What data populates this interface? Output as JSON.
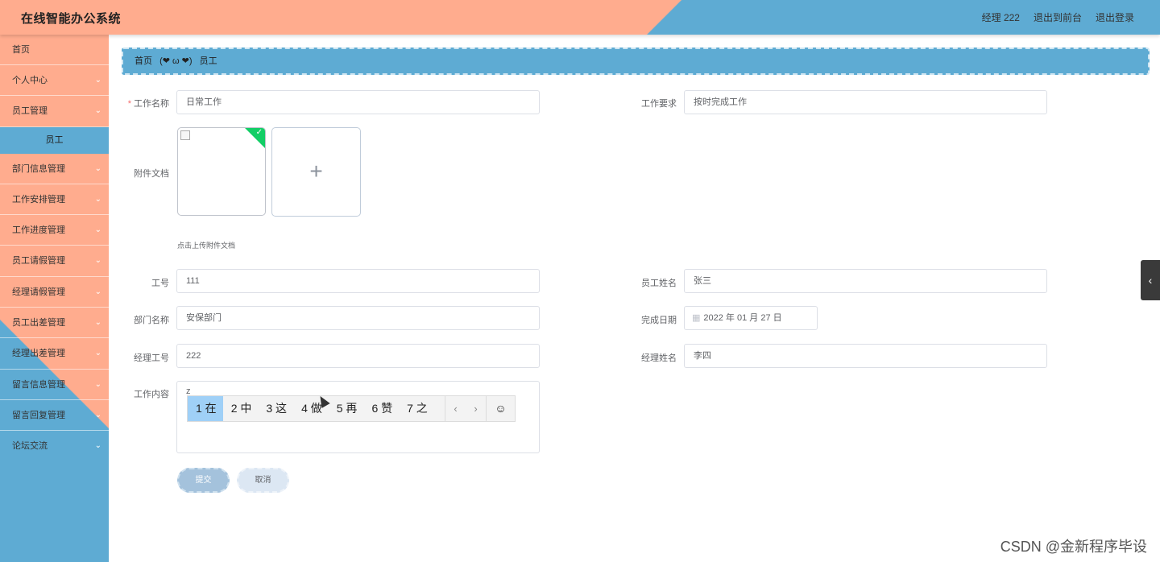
{
  "header": {
    "app_title": "在线智能办公系统",
    "user_label": "经理 222",
    "exit_front": "退出到前台",
    "logout": "退出登录"
  },
  "sidebar": {
    "items": [
      {
        "label": "首页",
        "has_children": false
      },
      {
        "label": "个人中心",
        "has_children": true
      },
      {
        "label": "员工管理",
        "has_children": true
      },
      {
        "label": "部门信息管理",
        "has_children": true
      },
      {
        "label": "工作安排管理",
        "has_children": true
      },
      {
        "label": "工作进度管理",
        "has_children": true
      },
      {
        "label": "员工请假管理",
        "has_children": true
      },
      {
        "label": "经理请假管理",
        "has_children": true
      },
      {
        "label": "员工出差管理",
        "has_children": true
      },
      {
        "label": "经理出差管理",
        "has_children": true
      },
      {
        "label": "留言信息管理",
        "has_children": true
      },
      {
        "label": "留言回复管理",
        "has_children": true
      },
      {
        "label": "论坛交流",
        "has_children": true
      }
    ],
    "sub_item": "员工",
    "chevron": "⌄"
  },
  "breadcrumb": {
    "home": "首页",
    "separator": "(❤ ω ❤)",
    "current": "员工"
  },
  "form": {
    "work_name_label": "工作名称",
    "work_name_value": "日常工作",
    "work_req_label": "工作要求",
    "work_req_value": "按时完成工作",
    "attachment_label": "附件文档",
    "upload_tip": "点击上传附件文档",
    "emp_no_label": "工号",
    "emp_no_value": "111",
    "emp_name_label": "员工姓名",
    "emp_name_value": "张三",
    "dept_label": "部门名称",
    "dept_value": "安保部门",
    "finish_date_label": "完成日期",
    "finish_date_value": "2022 年 01 月 27 日",
    "mgr_no_label": "经理工号",
    "mgr_no_value": "222",
    "mgr_name_label": "经理姓名",
    "mgr_name_value": "李四",
    "content_label": "工作内容",
    "content_value": "z",
    "submit": "提交",
    "cancel": "取消"
  },
  "ime": {
    "candidates": [
      "1 在",
      "2 中",
      "3 这",
      "4 做",
      "5 再",
      "6 赞",
      "7 之"
    ],
    "prev": "‹",
    "next": "›",
    "emoji": "☺"
  },
  "watermark": "CSDN @金新程序毕设",
  "colors": {
    "header_salmon": "#ffac8e",
    "header_blue": "#5eabd3",
    "required": "#f56c6c",
    "upload_success": "#13ce66"
  }
}
